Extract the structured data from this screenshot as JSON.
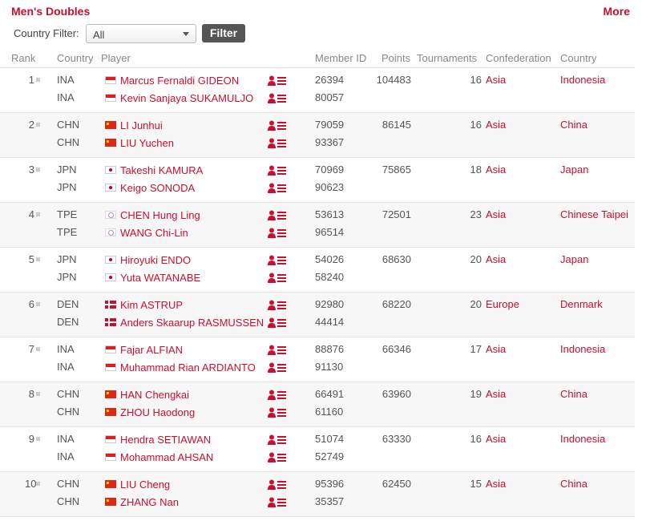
{
  "header": {
    "title": "Men's Doubles",
    "more_label": "More"
  },
  "filter": {
    "label": "Country Filter:",
    "selected": "All",
    "button_label": "Filter"
  },
  "columns": {
    "rank": "Rank",
    "country": "Country",
    "player": "Player",
    "member_id": "Member ID",
    "points": "Points",
    "tournaments": "Tournaments",
    "confederation": "Confederation",
    "country_name": "Country"
  },
  "icons": {
    "flag": "flag-icon",
    "profile": "player-profile-icon",
    "dropdown": "chevron-down-icon",
    "rank_marker": "rank-marker-icon"
  },
  "colors": {
    "accent": "#c8102e",
    "button": "#555555"
  },
  "rows": [
    {
      "rank": "1",
      "points": "104483",
      "tournaments": "16",
      "confederation": "Asia",
      "country_name": "Indonesia",
      "players": [
        {
          "country": "INA",
          "flag": "ina",
          "name": "Marcus Fernaldi GIDEON",
          "member_id": "26394"
        },
        {
          "country": "INA",
          "flag": "ina",
          "name": "Kevin Sanjaya SUKAMULJO",
          "member_id": "80057"
        }
      ]
    },
    {
      "rank": "2",
      "points": "86145",
      "tournaments": "16",
      "confederation": "Asia",
      "country_name": "China",
      "players": [
        {
          "country": "CHN",
          "flag": "chn",
          "name": "LI Junhui",
          "member_id": "79059"
        },
        {
          "country": "CHN",
          "flag": "chn",
          "name": "LIU Yuchen",
          "member_id": "93367"
        }
      ]
    },
    {
      "rank": "3",
      "points": "75865",
      "tournaments": "18",
      "confederation": "Asia",
      "country_name": "Japan",
      "players": [
        {
          "country": "JPN",
          "flag": "jpn",
          "name": "Takeshi KAMURA",
          "member_id": "70969"
        },
        {
          "country": "JPN",
          "flag": "jpn",
          "name": "Keigo SONODA",
          "member_id": "90623"
        }
      ]
    },
    {
      "rank": "4",
      "points": "72501",
      "tournaments": "23",
      "confederation": "Asia",
      "country_name": "Chinese Taipei",
      "players": [
        {
          "country": "TPE",
          "flag": "tpe",
          "name": "CHEN Hung Ling",
          "member_id": "53613"
        },
        {
          "country": "TPE",
          "flag": "tpe",
          "name": "WANG Chi-Lin",
          "member_id": "96514"
        }
      ]
    },
    {
      "rank": "5",
      "points": "68630",
      "tournaments": "20",
      "confederation": "Asia",
      "country_name": "Japan",
      "players": [
        {
          "country": "JPN",
          "flag": "jpn",
          "name": "Hiroyuki ENDO",
          "member_id": "54026"
        },
        {
          "country": "JPN",
          "flag": "jpn",
          "name": "Yuta WATANABE",
          "member_id": "58240"
        }
      ]
    },
    {
      "rank": "6",
      "points": "68220",
      "tournaments": "20",
      "confederation": "Europe",
      "country_name": "Denmark",
      "players": [
        {
          "country": "DEN",
          "flag": "den",
          "name": "Kim ASTRUP",
          "member_id": "92980"
        },
        {
          "country": "DEN",
          "flag": "den",
          "name": "Anders Skaarup RASMUSSEN",
          "member_id": "44414"
        }
      ]
    },
    {
      "rank": "7",
      "points": "66346",
      "tournaments": "17",
      "confederation": "Asia",
      "country_name": "Indonesia",
      "players": [
        {
          "country": "INA",
          "flag": "ina",
          "name": "Fajar ALFIAN",
          "member_id": "88876"
        },
        {
          "country": "INA",
          "flag": "ina",
          "name": "Muhammad Rian ARDIANTO",
          "member_id": "91130"
        }
      ]
    },
    {
      "rank": "8",
      "points": "63960",
      "tournaments": "19",
      "confederation": "Asia",
      "country_name": "China",
      "players": [
        {
          "country": "CHN",
          "flag": "chn",
          "name": "HAN Chengkai",
          "member_id": "66491"
        },
        {
          "country": "CHN",
          "flag": "chn",
          "name": "ZHOU Haodong",
          "member_id": "61160"
        }
      ]
    },
    {
      "rank": "9",
      "points": "63330",
      "tournaments": "16",
      "confederation": "Asia",
      "country_name": "Indonesia",
      "players": [
        {
          "country": "INA",
          "flag": "ina",
          "name": "Hendra SETIAWAN",
          "member_id": "51074"
        },
        {
          "country": "INA",
          "flag": "ina",
          "name": "Mohammad AHSAN",
          "member_id": "52749"
        }
      ]
    },
    {
      "rank": "10",
      "points": "62450",
      "tournaments": "15",
      "confederation": "Asia",
      "country_name": "China",
      "players": [
        {
          "country": "CHN",
          "flag": "chn",
          "name": "LIU Cheng",
          "member_id": "95396"
        },
        {
          "country": "CHN",
          "flag": "chn",
          "name": "ZHANG Nan",
          "member_id": "35357"
        }
      ]
    }
  ]
}
